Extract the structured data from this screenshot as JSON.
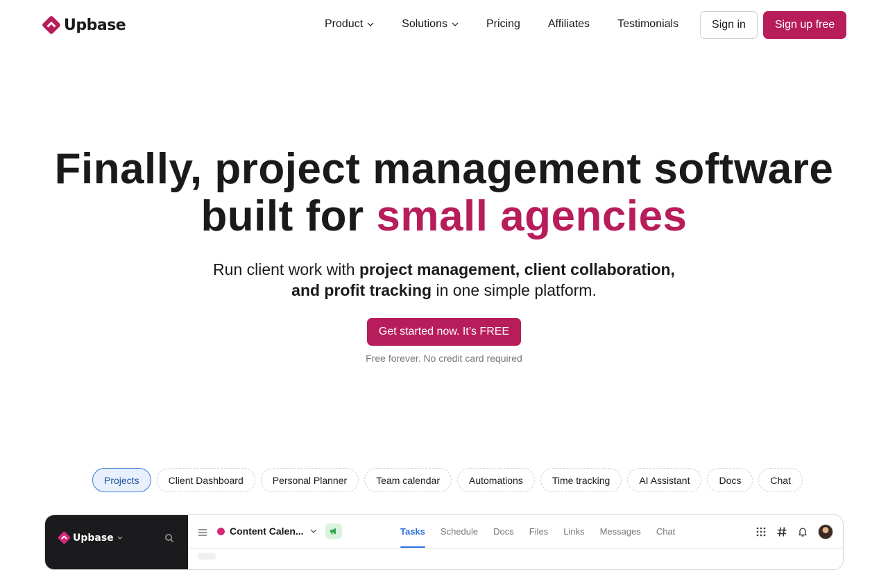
{
  "brand": {
    "name": "Upbase",
    "color": "#b81d5b"
  },
  "nav": {
    "items": [
      {
        "label": "Product",
        "has_dropdown": true
      },
      {
        "label": "Solutions",
        "has_dropdown": true
      },
      {
        "label": "Pricing",
        "has_dropdown": false
      },
      {
        "label": "Affiliates",
        "has_dropdown": false
      },
      {
        "label": "Testimonials",
        "has_dropdown": false
      }
    ],
    "signin_label": "Sign in",
    "signup_label": "Sign up free"
  },
  "hero": {
    "title_line1": "Finally, project management software",
    "title_line2_plain": "built for ",
    "title_line2_accent": "small agencies",
    "subtitle_pre": "Run client work with ",
    "subtitle_bold": "project management, client collaboration, and profit tracking",
    "subtitle_post": " in one simple platform.",
    "cta_label": "Get started now. It’s FREE",
    "cta_note": "Free forever. No credit card required"
  },
  "feature_tabs": {
    "active_index": 0,
    "items": [
      "Projects",
      "Client Dashboard",
      "Personal Planner",
      "Team calendar",
      "Automations",
      "Time tracking",
      "AI Assistant",
      "Docs",
      "Chat"
    ]
  },
  "app_preview": {
    "sidebar_brand": "Upbase",
    "project_name": "Content Calen...",
    "project_color": "#d4287a",
    "active_tab_index": 0,
    "tabs": [
      "Tasks",
      "Schedule",
      "Docs",
      "Files",
      "Links",
      "Messages",
      "Chat"
    ],
    "toolbar_icons": [
      "apps-grid-icon",
      "hashtag-icon",
      "bell-icon",
      "avatar"
    ]
  }
}
